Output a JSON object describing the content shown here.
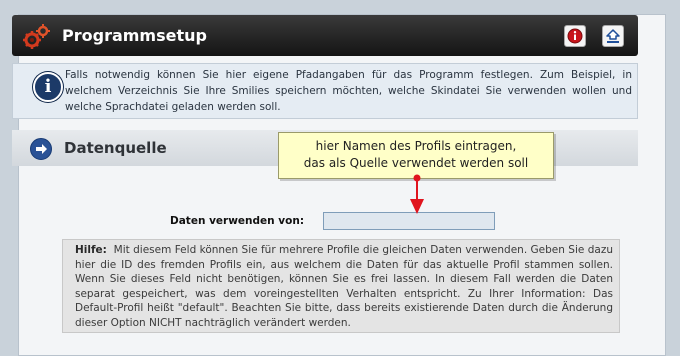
{
  "header": {
    "title": "Programmsetup",
    "icons": [
      "gears-icon",
      "info-icon",
      "collapse-up-icon"
    ]
  },
  "infobox": {
    "text": "Falls notwendig können Sie hier eigene Pfadangaben für das Programm festlegen. Zum Beispiel, in welchem Verzeichnis Sie Ihre Smilies speichern möchten, welche Skindatei Sie verwenden wollen und welche Sprachdatei geladen werden soll."
  },
  "section": {
    "title": "Datenquelle"
  },
  "form": {
    "label": "Daten verwenden von:",
    "value": ""
  },
  "help": {
    "label": "Hilfe:",
    "text": "Mit diesem Feld können Sie für mehrere Profile die gleichen Daten verwenden. Geben Sie dazu hier die ID des fremden Profils ein, aus welchem die Daten für das aktuelle Profil stammen sollen. Wenn Sie dieses Feld nicht benötigen, können Sie es frei lassen. In diesem Fall werden die Daten separat gespeichert, was dem voreingestellten Verhalten entspricht. Zu Ihrer Information: Das Default-Profil heißt \"default\". Beachten Sie bitte, dass bereits existierende Daten durch die Änderung dieser Option NICHT nachträglich verändert werden."
  },
  "annotation": {
    "line1": "hier Namen des Profils eintragen,",
    "line2": "das als Quelle verwendet werden soll"
  },
  "colors": {
    "header_bg": "#1e1e1e",
    "annotation_arrow": "#e0141e",
    "tooltip_bg": "#ffffc8"
  }
}
